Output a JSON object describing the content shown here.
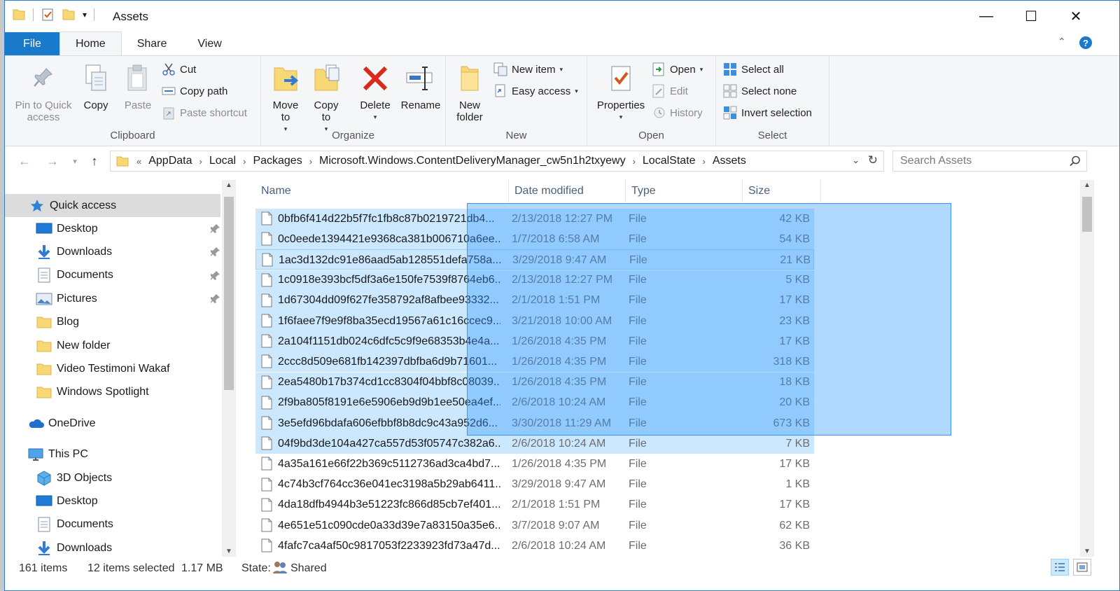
{
  "window": {
    "title": "Assets",
    "controls": {
      "minimize": "—",
      "maximize": "☐",
      "close": "✕"
    }
  },
  "ribbon_tabs": [
    "File",
    "Home",
    "Share",
    "View"
  ],
  "ribbon": {
    "clipboard": {
      "label": "Clipboard",
      "pin": "Pin to Quick\naccess",
      "copy": "Copy",
      "paste": "Paste",
      "cut": "Cut",
      "copy_path": "Copy path",
      "paste_shortcut": "Paste shortcut"
    },
    "organize": {
      "label": "Organize",
      "move_to": "Move\nto",
      "copy_to": "Copy\nto",
      "delete": "Delete",
      "rename": "Rename"
    },
    "new": {
      "label": "New",
      "new_folder": "New\nfolder",
      "new_item": "New item",
      "easy_access": "Easy access"
    },
    "open": {
      "label": "Open",
      "properties": "Properties",
      "open": "Open",
      "edit": "Edit",
      "history": "History"
    },
    "select": {
      "label": "Select",
      "select_all": "Select all",
      "select_none": "Select none",
      "invert": "Invert selection"
    }
  },
  "address": {
    "overflow": "«",
    "crumbs": [
      "AppData",
      "Local",
      "Packages",
      "Microsoft.Windows.ContentDeliveryManager_cw5n1h2txyewy",
      "LocalState",
      "Assets"
    ]
  },
  "search": {
    "placeholder": "Search Assets"
  },
  "nav": {
    "quick_access": "Quick access",
    "quick_items": [
      {
        "label": "Desktop",
        "icon": "desktop-icon",
        "pinned": true
      },
      {
        "label": "Downloads",
        "icon": "downloads-icon",
        "pinned": true
      },
      {
        "label": "Documents",
        "icon": "documents-icon",
        "pinned": true
      },
      {
        "label": "Pictures",
        "icon": "pictures-icon",
        "pinned": true
      },
      {
        "label": "Blog",
        "icon": "folder-icon",
        "pinned": false
      },
      {
        "label": "New folder",
        "icon": "folder-icon",
        "pinned": false
      },
      {
        "label": "Video Testimoni Wakaf",
        "icon": "folder-icon",
        "pinned": false
      },
      {
        "label": "Windows Spotlight",
        "icon": "folder-icon",
        "pinned": false
      }
    ],
    "onedrive": "OneDrive",
    "this_pc": "This PC",
    "pc_items": [
      {
        "label": "3D Objects",
        "icon": "3d-objects-icon"
      },
      {
        "label": "Desktop",
        "icon": "desktop-icon"
      },
      {
        "label": "Documents",
        "icon": "documents-icon"
      },
      {
        "label": "Downloads",
        "icon": "downloads-icon"
      }
    ]
  },
  "columns": {
    "name": "Name",
    "date": "Date modified",
    "type": "Type",
    "size": "Size"
  },
  "files": [
    {
      "name": "0bfb6f414d22b5f7fc1fb8c87b0219721db4...",
      "date": "2/13/2018 12:27 PM",
      "type": "File",
      "size": "42 KB",
      "selected": true
    },
    {
      "name": "0c0eede1394421e9368ca381b006710a6ee...",
      "date": "1/7/2018 6:58 AM",
      "type": "File",
      "size": "54 KB",
      "selected": true
    },
    {
      "name": "1ac3d132dc91e86aad5ab128551defa758a...",
      "date": "3/29/2018 9:47 AM",
      "type": "File",
      "size": "21 KB",
      "selected": true,
      "focused": true
    },
    {
      "name": "1c0918e393bcf5df3a6e150fe7539f8764eb6...",
      "date": "2/13/2018 12:27 PM",
      "type": "File",
      "size": "5 KB",
      "selected": true
    },
    {
      "name": "1d67304dd09f627fe358792af8afbee93332...",
      "date": "2/1/2018 1:51 PM",
      "type": "File",
      "size": "17 KB",
      "selected": true
    },
    {
      "name": "1f6faee7f9e9f8ba35ecd19567a61c16ccec9...",
      "date": "3/21/2018 10:00 AM",
      "type": "File",
      "size": "23 KB",
      "selected": true
    },
    {
      "name": "2a104f1151db024c6dfc5c9f9e68353b4e4a...",
      "date": "1/26/2018 4:35 PM",
      "type": "File",
      "size": "17 KB",
      "selected": true
    },
    {
      "name": "2ccc8d509e681fb142397dbfba6d9b71601...",
      "date": "1/26/2018 4:35 PM",
      "type": "File",
      "size": "318 KB",
      "selected": true
    },
    {
      "name": "2ea5480b17b374cd1cc8304f04bbf8c08039...",
      "date": "1/26/2018 4:35 PM",
      "type": "File",
      "size": "18 KB",
      "selected": true
    },
    {
      "name": "2f9ba805f8191e6e5906eb9d9b1ee50ea4ef...",
      "date": "2/6/2018 10:24 AM",
      "type": "File",
      "size": "20 KB",
      "selected": true
    },
    {
      "name": "3e5efd96bdafa606efbbf8b8dc9c43a952d6...",
      "date": "3/30/2018 11:29 AM",
      "type": "File",
      "size": "673 KB",
      "selected": true
    },
    {
      "name": "04f9bd3de104a427ca557d53f05747c382a6...",
      "date": "2/6/2018 10:24 AM",
      "type": "File",
      "size": "7 KB",
      "selected": true
    },
    {
      "name": "4a35a161e66f22b369c5112736ad3ca4bd7...",
      "date": "1/26/2018 4:35 PM",
      "type": "File",
      "size": "17 KB",
      "selected": false
    },
    {
      "name": "4c74b3cf764cc36e041ec3198a5b29ab6411...",
      "date": "3/29/2018 9:47 AM",
      "type": "File",
      "size": "1 KB",
      "selected": false
    },
    {
      "name": "4da18dfb4944b3e51223fc866d85cb7ef401...",
      "date": "2/1/2018 1:51 PM",
      "type": "File",
      "size": "17 KB",
      "selected": false
    },
    {
      "name": "4e651e51c090cde0a33d39e7a83150a35e6...",
      "date": "3/7/2018 9:07 AM",
      "type": "File",
      "size": "62 KB",
      "selected": false
    },
    {
      "name": "4fafc7ca4af50c9817053f2233923fd73a47d...",
      "date": "2/6/2018 10:24 AM",
      "type": "File",
      "size": "36 KB",
      "selected": false
    }
  ],
  "status": {
    "items": "161 items",
    "selected": "12 items selected",
    "size": "1.17 MB",
    "state_label": "State:",
    "state_value": "Shared"
  },
  "colors": {
    "accent": "#1979ca",
    "selection": "#cce8ff",
    "marquee": "#3399ff"
  }
}
